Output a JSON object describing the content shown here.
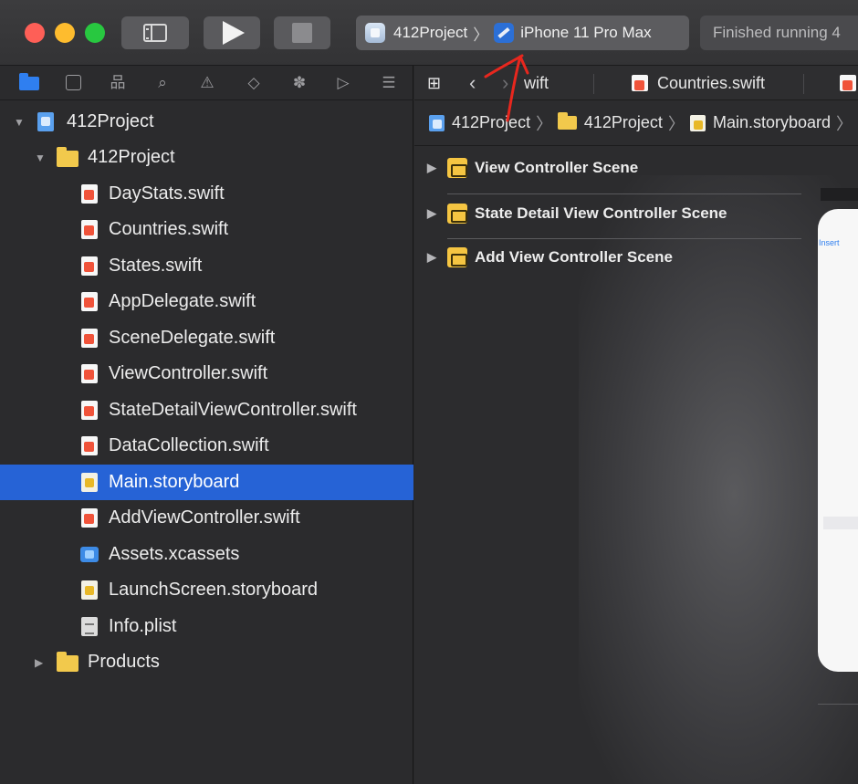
{
  "toolbar": {
    "scheme_project": "412Project",
    "scheme_device": "iPhone 11 Pro Max",
    "status_text": "Finished running 4"
  },
  "navigator": {
    "tab_icons": [
      "folder-icon",
      "source-control-icon",
      "symbol-icon",
      "search-icon",
      "warning-icon",
      "test-icon",
      "debug-icon",
      "breakpoint-icon",
      "report-icon"
    ],
    "project_name": "412Project",
    "group_name": "412Project",
    "files": [
      {
        "label": "DayStats.swift",
        "kind": "swift"
      },
      {
        "label": "Countries.swift",
        "kind": "swift"
      },
      {
        "label": "States.swift",
        "kind": "swift"
      },
      {
        "label": "AppDelegate.swift",
        "kind": "swift"
      },
      {
        "label": "SceneDelegate.swift",
        "kind": "swift"
      },
      {
        "label": "ViewController.swift",
        "kind": "swift"
      },
      {
        "label": "StateDetailViewController.swift",
        "kind": "swift"
      },
      {
        "label": "DataCollection.swift",
        "kind": "swift"
      },
      {
        "label": "Main.storyboard",
        "kind": "storyboard",
        "selected": true
      },
      {
        "label": "AddViewController.swift",
        "kind": "swift"
      },
      {
        "label": "Assets.xcassets",
        "kind": "assets"
      },
      {
        "label": "LaunchScreen.storyboard",
        "kind": "storyboard"
      },
      {
        "label": "Info.plist",
        "kind": "plist"
      }
    ],
    "products_label": "Products"
  },
  "editor": {
    "tabs": [
      "wift",
      "Countries.swift"
    ],
    "jump_bar": [
      "412Project",
      "412Project",
      "Main.storyboard"
    ],
    "scenes": [
      "View Controller Scene",
      "State Detail View Controller Scene",
      "Add View Controller Scene"
    ],
    "canvas_insert": "Insert"
  },
  "colors": {
    "selection": "#2663d6",
    "annotation_arrow": "#e8271e"
  }
}
